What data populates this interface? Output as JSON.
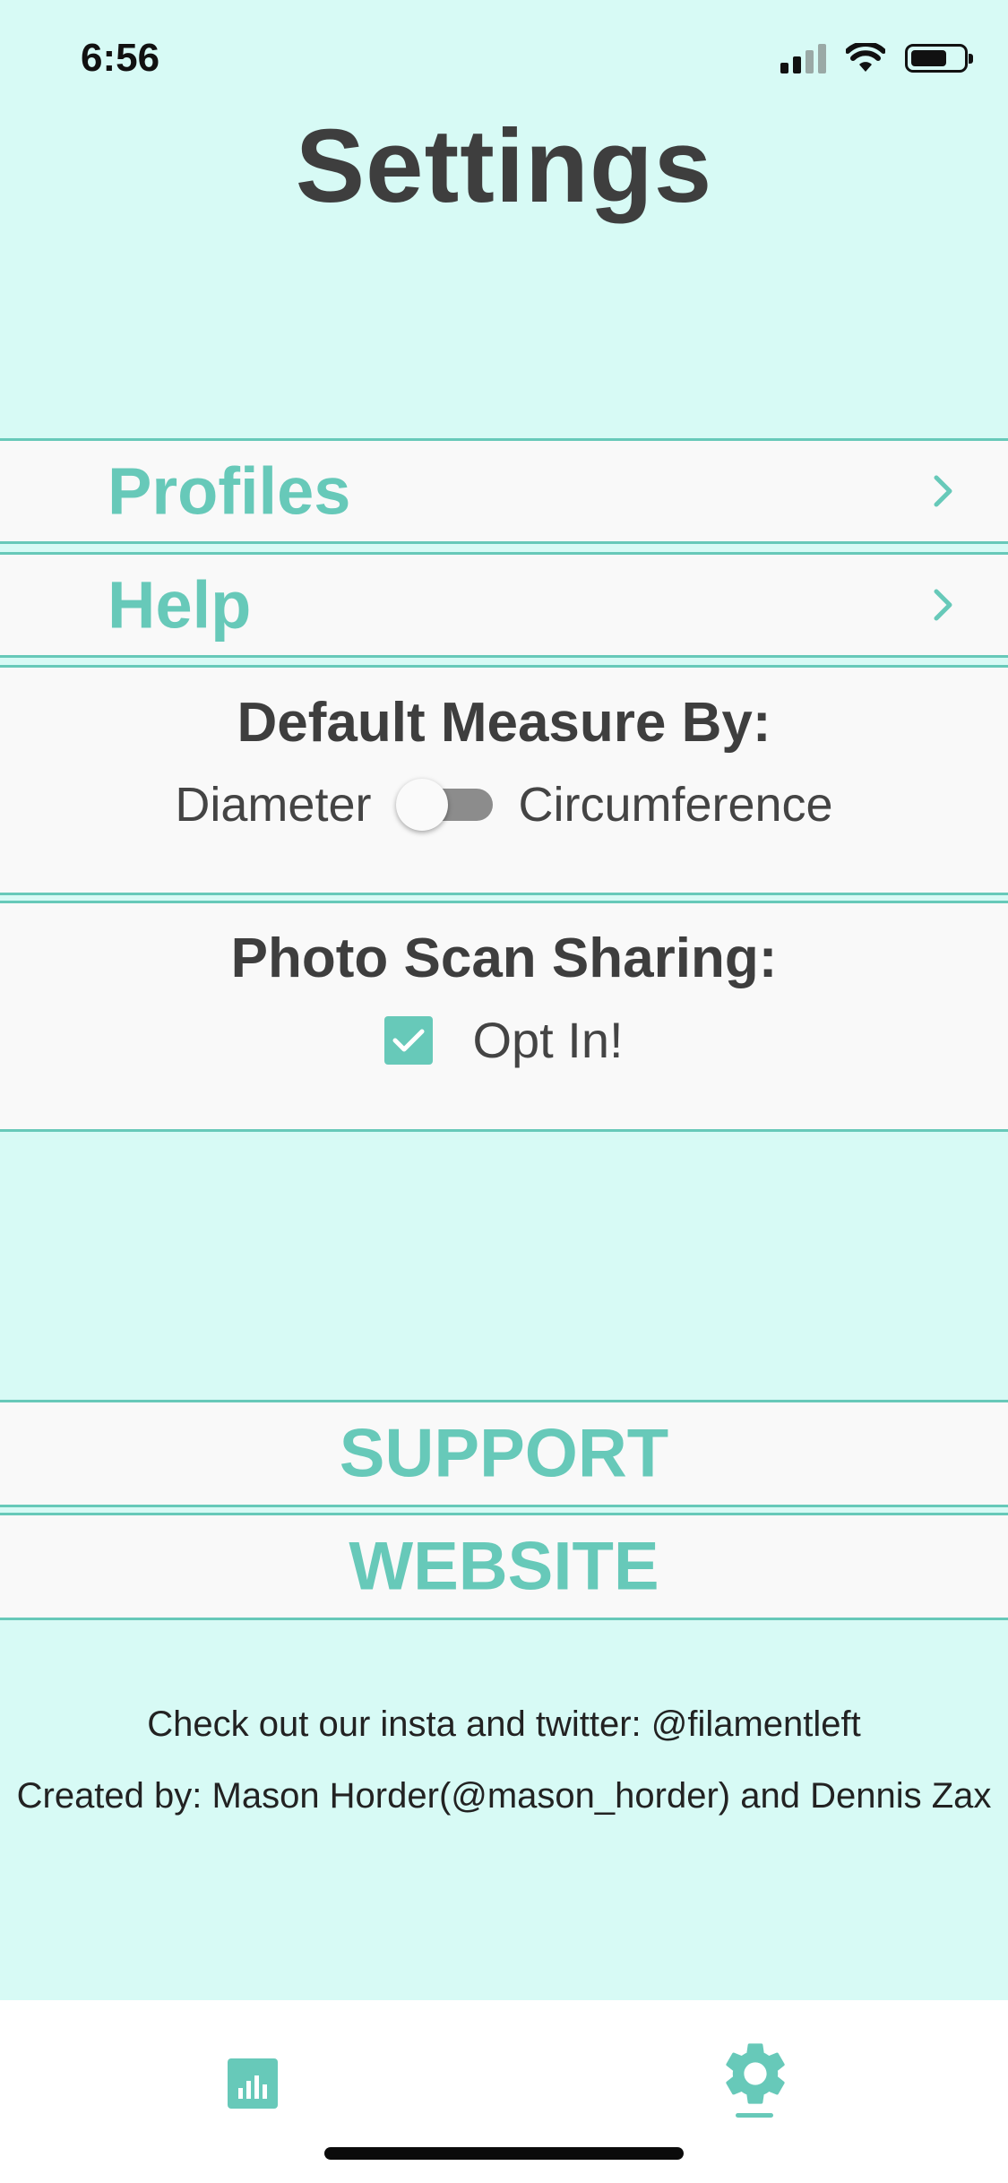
{
  "status_bar": {
    "time": "6:56",
    "battery_level": 0.7
  },
  "page": {
    "title": "Settings"
  },
  "menu": {
    "profiles_label": "Profiles",
    "help_label": "Help"
  },
  "measure": {
    "title": "Default Measure By:",
    "left_option": "Diameter",
    "right_option": "Circumference",
    "selected": "Diameter"
  },
  "sharing": {
    "title": "Photo Scan Sharing:",
    "checkbox_label": "Opt In!",
    "checked": true
  },
  "links": {
    "support_label": "SUPPORT",
    "website_label": "WEBSITE"
  },
  "footer": {
    "social_text": "Check out our insta and twitter: @filamentleft",
    "credits_text": "Created by: Mason Horder(@mason_horder) and Dennis Zax"
  },
  "tab_bar": {
    "tabs": [
      {
        "icon": "bar-chart-icon",
        "active": false
      },
      {
        "icon": "gear-icon",
        "active": true
      }
    ]
  },
  "colors": {
    "accent": "#67c9b9",
    "background": "#d7faf5",
    "row": "#f9f9f9",
    "text": "#3e3e3e"
  }
}
